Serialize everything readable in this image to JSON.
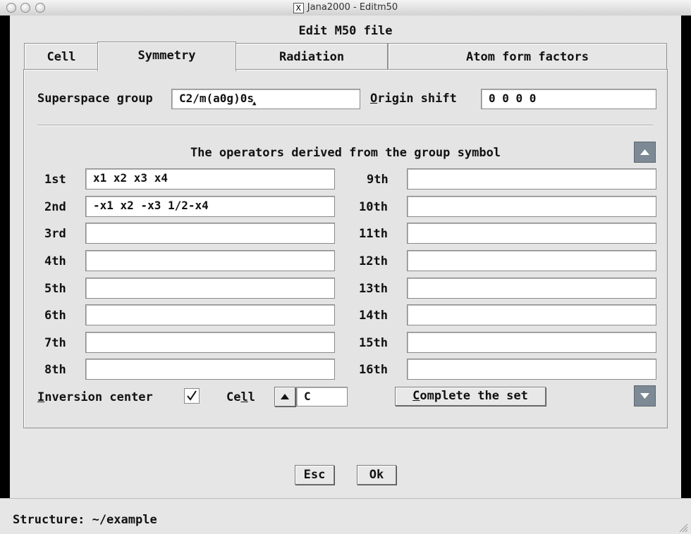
{
  "window": {
    "title": "Jana2000 - Editm50",
    "heading": "Edit M50 file"
  },
  "tabs": [
    {
      "label": "Cell",
      "active": false
    },
    {
      "label": "Symmetry",
      "active": true
    },
    {
      "label": "Radiation",
      "active": false
    },
    {
      "label": "Atom form factors",
      "active": false
    }
  ],
  "symmetry": {
    "superspace_label": "Superspace group",
    "superspace_value": "C2/m(a0g)0s",
    "origin_label_first": "O",
    "origin_label_rest": "rigin shift",
    "origin_value": "0 0 0 0",
    "operators_title": "The operators derived from the group symbol",
    "left_rows": [
      {
        "label": "1st",
        "value": "x1 x2 x3 x4"
      },
      {
        "label": "2nd",
        "value": "-x1 x2 -x3 1/2-x4"
      },
      {
        "label": "3rd",
        "value": ""
      },
      {
        "label": "4th",
        "value": ""
      },
      {
        "label": "5th",
        "value": ""
      },
      {
        "label": "6th",
        "value": ""
      },
      {
        "label": "7th",
        "value": ""
      },
      {
        "label": "8th",
        "value": ""
      }
    ],
    "right_rows": [
      {
        "label": "9th",
        "value": ""
      },
      {
        "label": "10th",
        "value": ""
      },
      {
        "label": "11th",
        "value": ""
      },
      {
        "label": "12th",
        "value": ""
      },
      {
        "label": "13th",
        "value": ""
      },
      {
        "label": "14th",
        "value": ""
      },
      {
        "label": "15th",
        "value": ""
      },
      {
        "label": "16th",
        "value": ""
      }
    ],
    "inversion_label_first": "I",
    "inversion_label_rest": "nversion center",
    "inversion_checked": true,
    "cell_label_a": "Ce",
    "cell_label_b": "l",
    "cell_label_c": "l",
    "cell_value": "C",
    "complete_first": "C",
    "complete_rest": "omplete the set"
  },
  "buttons": {
    "esc": "Esc",
    "ok": "Ok"
  },
  "status": {
    "text": "Structure: ~/example"
  },
  "colors": {
    "scroll_button": "#7d8a95",
    "background": "#e6e6e6"
  }
}
